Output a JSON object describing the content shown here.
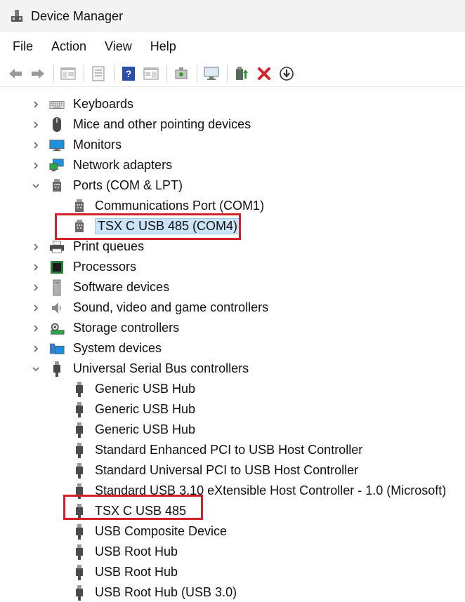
{
  "window": {
    "title": "Device Manager"
  },
  "menu": [
    "File",
    "Action",
    "View",
    "Help"
  ],
  "toolbar_icons": [
    "back-arrow-icon",
    "forward-arrow-icon",
    "show-hide-tree-icon",
    "properties-icon",
    "help-icon",
    "view-details-icon",
    "scan-hardware-icon",
    "monitor-icon",
    "update-driver-icon",
    "uninstall-icon",
    "download-icon"
  ],
  "tree": {
    "keyboards": "Keyboards",
    "mice": "Mice and other pointing devices",
    "monitors": "Monitors",
    "network": "Network adapters",
    "ports": "Ports (COM & LPT)",
    "ports_children": [
      "Communications Port (COM1)",
      "TSX C USB 485 (COM4)"
    ],
    "print": "Print queues",
    "processors": "Processors",
    "software": "Software devices",
    "sound": "Sound, video and game controllers",
    "storage": "Storage controllers",
    "system": "System devices",
    "usb": "Universal Serial Bus controllers",
    "usb_children": [
      "Generic USB Hub",
      "Generic USB Hub",
      "Generic USB Hub",
      "Standard Enhanced PCI to USB Host Controller",
      "Standard Universal PCI to USB Host Controller",
      "Standard USB 3.10 eXtensible Host Controller - 1.0 (Microsoft)",
      "TSX C USB 485",
      "USB Composite Device",
      "USB Root Hub",
      "USB Root Hub",
      "USB Root Hub (USB 3.0)"
    ]
  },
  "highlight_color": "#d4202a",
  "selection_color": "#cce4f7"
}
